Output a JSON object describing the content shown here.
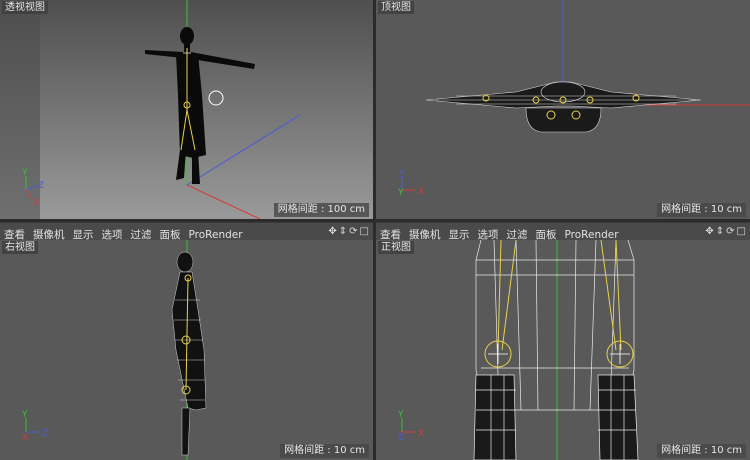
{
  "viewports": {
    "perspective": {
      "label": "透视视图",
      "grid": "网格间距 : 100 cm"
    },
    "top": {
      "label": "顶视图",
      "grid": "网格间距 : 10 cm"
    },
    "right": {
      "label": "右视图",
      "grid": "网格间距 : 10 cm"
    },
    "front": {
      "label": "正视图",
      "grid": "网格间距 : 10 cm"
    }
  },
  "menu": {
    "items": [
      "查看",
      "摄像机",
      "显示",
      "选项",
      "过滤",
      "面板",
      "ProRender"
    ]
  },
  "axes": {
    "x": "X",
    "y": "Y",
    "z": "Z"
  },
  "colors": {
    "x_axis": "#d23c3c",
    "y_axis": "#3cc03c",
    "z_axis": "#4a5ad8",
    "joint": "#e8d24a",
    "viewport_bg": "#595959"
  }
}
